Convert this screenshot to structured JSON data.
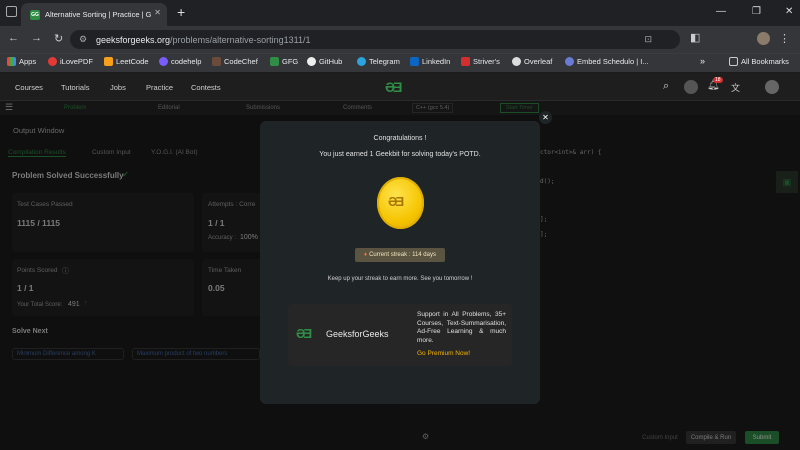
{
  "browser": {
    "tab_title": "Alternative Sorting | Practice | G",
    "url_host": "geeksforgeeks.org",
    "url_path": "/problems/alternative-sorting1311/1",
    "bookmarks": [
      "Apps",
      "iLovePDF",
      "LeetCode",
      "codehelp",
      "CodeChef",
      "GFG",
      "GitHub",
      "Telegram",
      "LinkedIn",
      "Striver's",
      "Overleaf",
      "Embed Schedulo | I...",
      "All Bookmarks"
    ]
  },
  "nav": {
    "items": [
      "Courses",
      "Tutorials",
      "Jobs",
      "Practice",
      "Contests"
    ],
    "notif_count": "18"
  },
  "problem_tabs": [
    "Problem",
    "Editorial",
    "Submissions",
    "Comments"
  ],
  "editor": {
    "language": "C++ (gcc 5.4)",
    "timer": "Start Timer",
    "code_fragments": [
      "ctor<int>& arr) {",
      "d();",
      "];",
      "];"
    ],
    "custom_input": "Custom Input",
    "compile_btn": "Compile & Run",
    "submit_btn": "Submit"
  },
  "output": {
    "title": "Output Window",
    "tabs": [
      "Compilation Results",
      "Custom Input",
      "Y.O.G.I. (AI Bot)"
    ],
    "status": "Problem Solved Successfully",
    "test_cases_label": "Test Cases Passed",
    "test_cases_value": "1115 / 1115",
    "attempts_label": "Attempts : Corre",
    "attempts_value": "1 / 1",
    "accuracy_label": "Accuracy :",
    "accuracy_value": "100%",
    "points_label": "Points Scored",
    "points_value": "1 / 1",
    "total_score_label": "Your Total Score:",
    "total_score_value": "491",
    "time_label": "Time Taken",
    "time_value": "0.05",
    "solve_next": "Solve Next",
    "next_items": [
      "Minimum Difference among K",
      "Maximum product of two numbers"
    ]
  },
  "modal": {
    "title": "Congratulations !",
    "message": "You just earned 1 Geekbit for solving today's POTD.",
    "streak": "Current streak : 114 days",
    "footer": "Keep up your streak to earn more. See you tomorrow !",
    "promo_brand": "GeeksforGeeks",
    "promo_text": "Support in All Problems, 35+ Courses, Text-Summarisation, Ad-Free Learning & much more.",
    "promo_link": "Go Premium Now!",
    "colors": {
      "accent": "#2f8d46",
      "coin": "#f5c400",
      "link": "#f5b400"
    }
  }
}
